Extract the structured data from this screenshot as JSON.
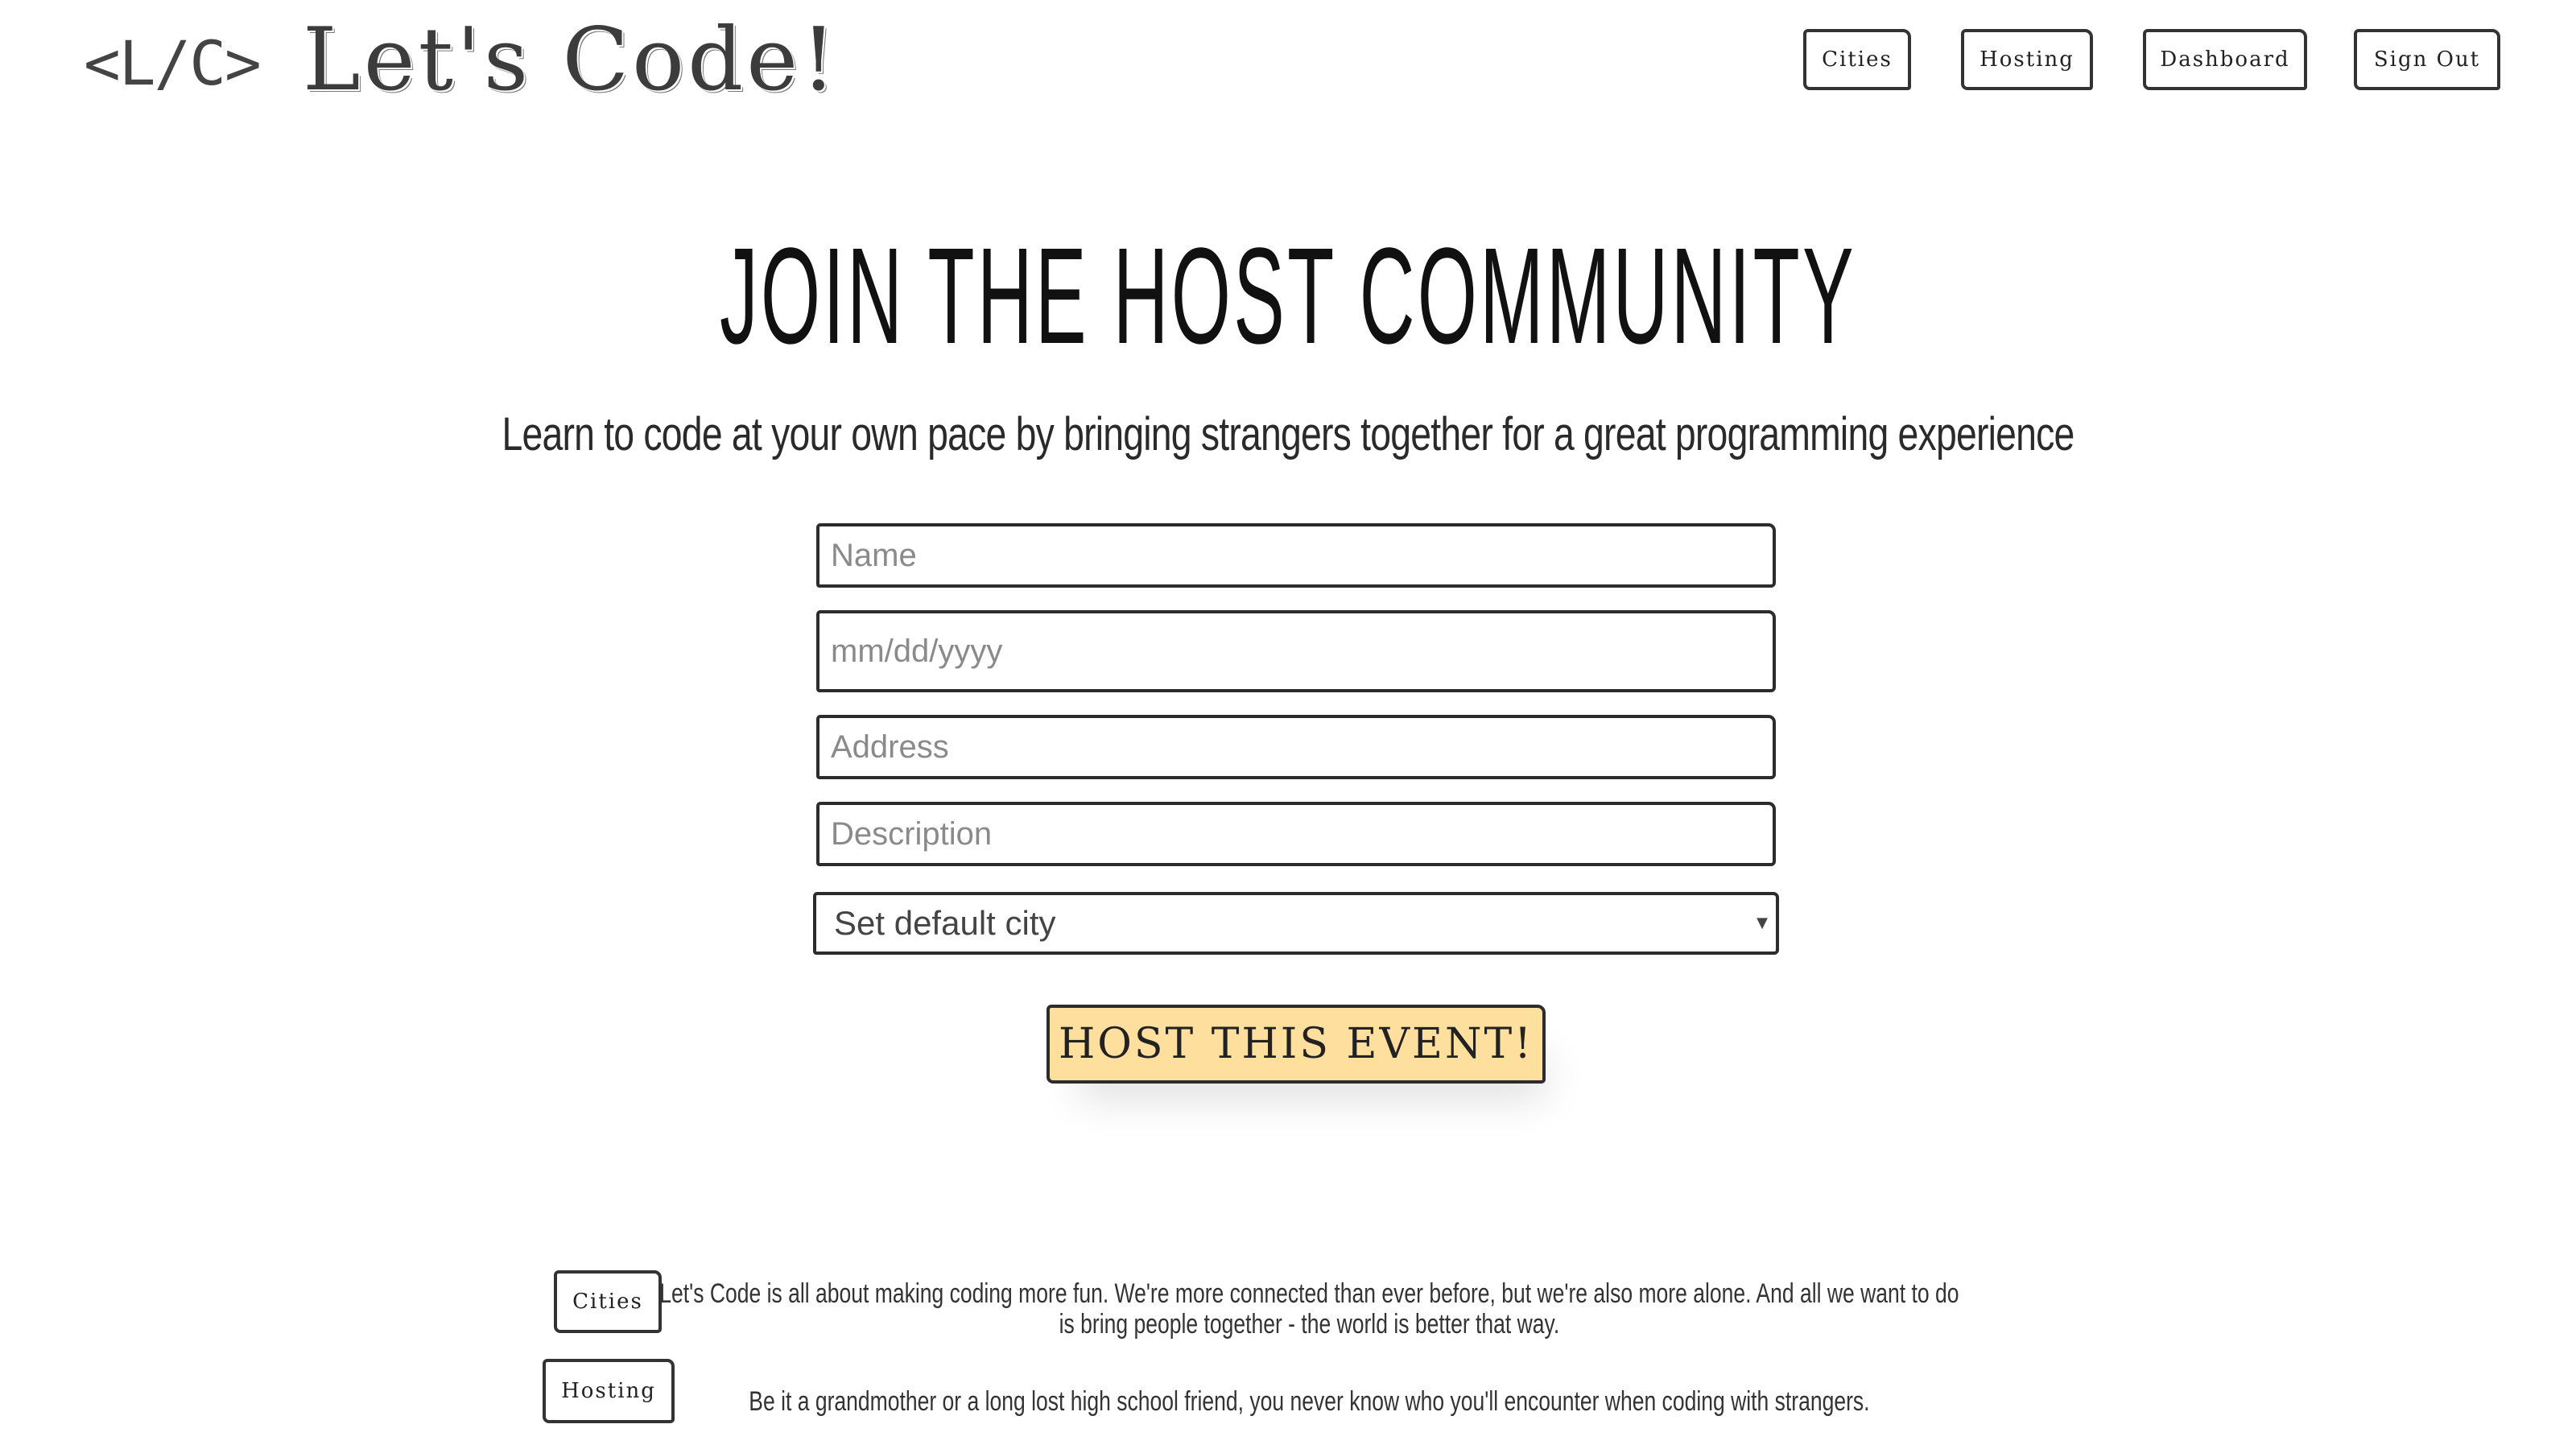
{
  "header": {
    "logo_mark": "<L/C>",
    "logo_title": "Let's Code!",
    "nav": {
      "cities": "Cities",
      "hosting": "Hosting",
      "dashboard": "Dashboard",
      "sign_out": "Sign Out"
    }
  },
  "hero": {
    "title": "JOIN THE HOST COMMUNITY",
    "subtitle": "Learn to code at your own pace by bringing strangers together for a great programming experience"
  },
  "form": {
    "name_placeholder": "Name",
    "date_placeholder": "mm/dd/yyyy",
    "address_placeholder": "Address",
    "description_placeholder": "Description",
    "city_select_value": "Set default city",
    "submit_label": "HOST THIS EVENT!"
  },
  "footer": {
    "links": {
      "cities": "Cities",
      "hosting": "Hosting"
    },
    "about_line1": "Let's Code is all about making coding more fun. We're more connected than ever before, but we're also more alone. And all we want to do",
    "about_line2": "is bring people together - the world is better that way.",
    "about_line3": "Be it a grandmother or a long lost high school friend, you never know who you'll encounter when coding with strangers."
  },
  "colors": {
    "submit_background": "#ffdf9e",
    "border": "#2c2c2c",
    "text": "#222222"
  },
  "icons": {
    "select_arrow": "caret-down-icon"
  }
}
